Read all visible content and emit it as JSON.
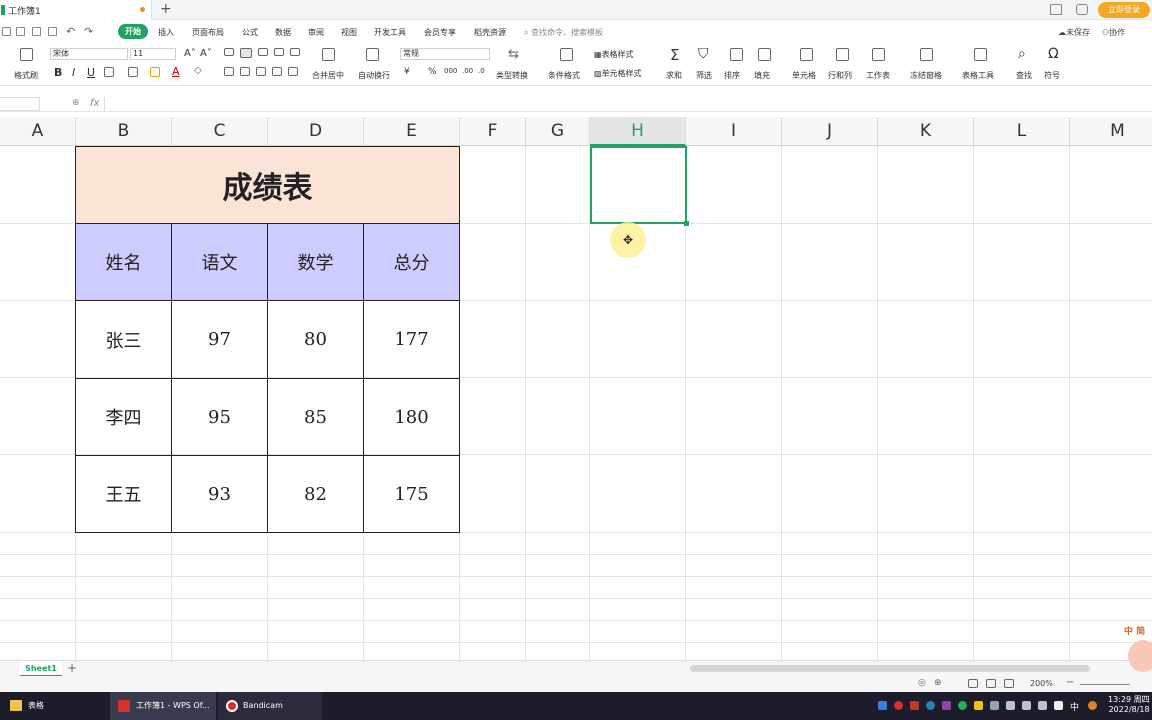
{
  "window": {
    "doc_title": "工作簿1",
    "new_tab": "+",
    "login_button": "立即登录"
  },
  "menu": {
    "items": [
      "开始",
      "插入",
      "页面布局",
      "公式",
      "数据",
      "审阅",
      "视图",
      "开发工具",
      "会员专享",
      "稻壳资源"
    ],
    "search_placeholder": "查找命令、搜索模板",
    "unsaved": "未保存",
    "collab": "协作"
  },
  "ribbon": {
    "format_painter": "格式刷",
    "font_name": "宋体",
    "font_size": "11",
    "merge_center": "合并居中",
    "wrap_text": "自动换行",
    "number_format": "常规",
    "type_convert": "类型转换",
    "cond_format": "条件格式",
    "table_style": "表格样式",
    "cell_style": "单元格样式",
    "sum": "求和",
    "filter": "筛选",
    "sort": "排序",
    "fill": "填充",
    "cell": "单元格",
    "row_col": "行和列",
    "worksheet": "工作表",
    "freeze": "冻结窗格",
    "table_tools": "表格工具",
    "find": "查找",
    "symbol": "符号",
    "font_buttons": [
      "B",
      "I",
      "U"
    ]
  },
  "formula": {
    "fx": "fx",
    "value": ""
  },
  "columns": [
    "A",
    "B",
    "C",
    "D",
    "E",
    "F",
    "G",
    "H",
    "I",
    "J",
    "K",
    "L",
    "M"
  ],
  "selected_column": "H",
  "table": {
    "title": "成绩表",
    "headers": [
      "姓名",
      "语文",
      "数学",
      "总分"
    ],
    "rows": [
      [
        "张三",
        "97",
        "80",
        "177"
      ],
      [
        "李四",
        "95",
        "85",
        "180"
      ],
      [
        "王五",
        "93",
        "82",
        "175"
      ]
    ]
  },
  "sheets": {
    "tabs": [
      "Sheet1"
    ],
    "add": "+"
  },
  "status": {
    "zoom": "200%"
  },
  "taskbar": {
    "items": [
      "表格",
      "工作簿1 - WPS Of...",
      "Bandicam"
    ],
    "time": "13:29 周四",
    "date": "2022/8/18",
    "ime": "中"
  },
  "watermark": "中 简"
}
